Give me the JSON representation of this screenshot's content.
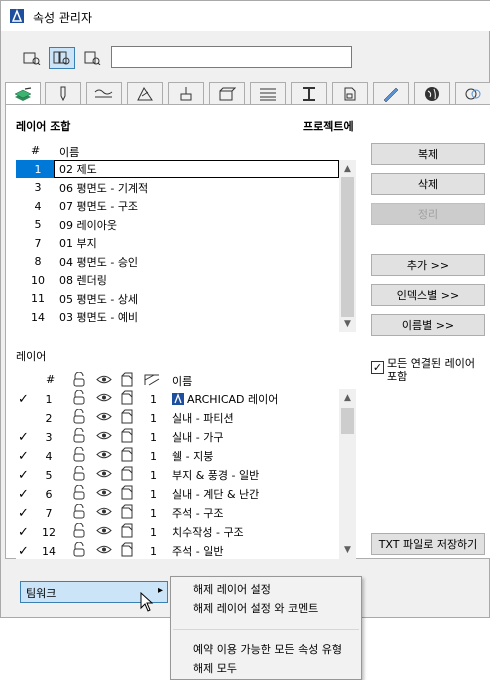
{
  "window": {
    "title": "속성 관리자"
  },
  "search": {
    "value": "",
    "placeholder": ""
  },
  "view_buttons": [
    {
      "icon": "list-view-icon"
    },
    {
      "icon": "details-view-icon"
    },
    {
      "icon": "preview-view-icon"
    }
  ],
  "tabs": [
    {
      "icon": "layers-icon"
    },
    {
      "icon": "pen-icon"
    },
    {
      "icon": "line-types-icon"
    },
    {
      "icon": "fill-types-icon"
    },
    {
      "icon": "surfaces-icon"
    },
    {
      "icon": "building-materials-icon"
    },
    {
      "icon": "composites-icon"
    },
    {
      "icon": "profiles-icon"
    },
    {
      "icon": "zone-categories-icon"
    },
    {
      "icon": "markup-styles-icon"
    },
    {
      "icon": "globe-icon"
    },
    {
      "icon": "mep-icon"
    }
  ],
  "layer_combinations": {
    "heading": "레이어 조합",
    "source_label": "프로젝트에",
    "columns": {
      "num": "#",
      "name": "이름"
    },
    "rows": [
      {
        "num": "1",
        "name": "02 제도",
        "selected": true
      },
      {
        "num": "3",
        "name": "06 평면도 - 기계적"
      },
      {
        "num": "4",
        "name": "07 평면도 - 구조"
      },
      {
        "num": "5",
        "name": "09 레이아웃"
      },
      {
        "num": "7",
        "name": "01 부지"
      },
      {
        "num": "8",
        "name": "04 평면도 - 승인"
      },
      {
        "num": "10",
        "name": "08 렌더링"
      },
      {
        "num": "11",
        "name": "05 평면도 - 상세"
      },
      {
        "num": "14",
        "name": "03 평면도 - 예비"
      }
    ]
  },
  "actions": {
    "duplicate": "복제",
    "delete": "삭제",
    "cleanup": "정리",
    "add": "추가 >>",
    "by_index": "인덱스별 >>",
    "by_name": "이름별 >>",
    "save_txt": "TXT 파일로 저장하기"
  },
  "include_linked": {
    "label": "모든 연결된 레이어 포함",
    "checked": true
  },
  "layers": {
    "heading": "레이어",
    "columns": {
      "num": "#",
      "name": "이름"
    },
    "rows": [
      {
        "check": "✓",
        "num": "1",
        "intersect": "1",
        "name": "ARCHICAD 레이어",
        "archicad_icon": true
      },
      {
        "check": "",
        "num": "2",
        "intersect": "1",
        "name": "실내 - 파티션"
      },
      {
        "check": "✓",
        "num": "3",
        "intersect": "1",
        "name": "실내 - 가구"
      },
      {
        "check": "✓",
        "num": "4",
        "intersect": "1",
        "name": "쉘 - 지붕"
      },
      {
        "check": "✓",
        "num": "5",
        "intersect": "1",
        "name": "부지 & 풍경 - 일반"
      },
      {
        "check": "✓",
        "num": "6",
        "intersect": "1",
        "name": "실내 - 계단 & 난간"
      },
      {
        "check": "✓",
        "num": "7",
        "intersect": "1",
        "name": "주석 - 구조"
      },
      {
        "check": "✓",
        "num": "12",
        "intersect": "1",
        "name": "치수작성 - 구조"
      },
      {
        "check": "✓",
        "num": "14",
        "intersect": "1",
        "name": "주석 - 일반"
      }
    ]
  },
  "teamwork": {
    "label": "팀워크",
    "arrow": "▸"
  },
  "teamwork_menu": {
    "items": [
      "해제 레이어 설정",
      "해제 레이어 설정 와 코멘트"
    ],
    "items2": [
      "예약 이용 가능한 모든 속성 유형",
      "해제 모두"
    ]
  }
}
